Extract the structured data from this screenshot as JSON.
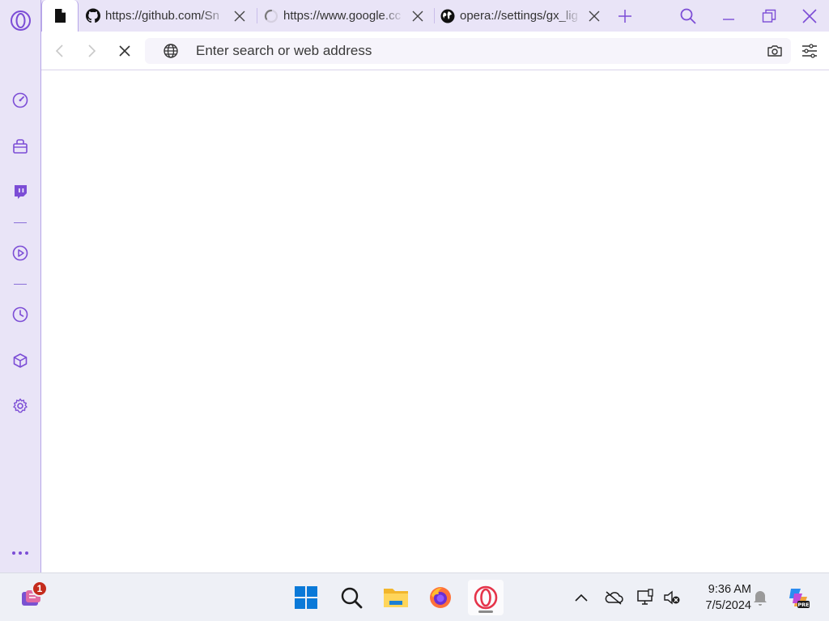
{
  "browser": {
    "name": "Opera GX",
    "accent_color": "#7c4dd6",
    "sidebar": {
      "items": [
        {
          "name": "speed-dial",
          "icon": "speedometer-icon"
        },
        {
          "name": "extensions-bag",
          "icon": "bag-icon"
        },
        {
          "name": "twitch",
          "icon": "twitch-icon"
        },
        {
          "name": "player",
          "icon": "play-circle-icon"
        },
        {
          "name": "history",
          "icon": "clock-icon"
        },
        {
          "name": "extensions",
          "icon": "cube-icon"
        },
        {
          "name": "settings",
          "icon": "gear-icon"
        }
      ],
      "more": "more-icon"
    },
    "tabs": [
      {
        "title": "",
        "icon": "page-icon",
        "active": true
      },
      {
        "title": "https://github.com/Sn",
        "icon": "github-icon",
        "active": false
      },
      {
        "title": "https://www.google.cc",
        "icon": "loading-spinner-icon",
        "active": false
      },
      {
        "title": "opera://settings/gx_lig",
        "icon": "globe-filled-icon",
        "active": false
      }
    ],
    "address_bar": {
      "placeholder": "Enter search or web address",
      "value": ""
    }
  },
  "taskbar": {
    "apps": [
      {
        "name": "start",
        "icon": "windows-start-icon"
      },
      {
        "name": "search",
        "icon": "search-icon"
      },
      {
        "name": "file-explorer",
        "icon": "folder-icon"
      },
      {
        "name": "firefox",
        "icon": "firefox-icon"
      },
      {
        "name": "opera-gx",
        "icon": "opera-icon",
        "active": true
      }
    ],
    "widget_badge": "1",
    "clock": {
      "time": "9:36 AM",
      "date": "7/5/2024"
    }
  }
}
